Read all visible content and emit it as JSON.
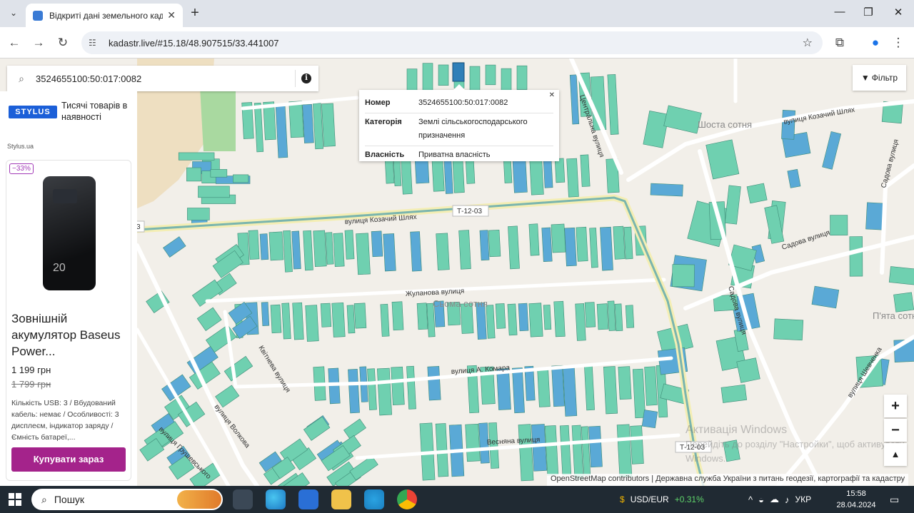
{
  "browser": {
    "tab_title": "Відкриті дані земельного када",
    "url": "kadastr.live/#15.18/48.907515/33.441007"
  },
  "search": {
    "value": "3524655100:50:017:0082"
  },
  "filter_label": "Фільтр",
  "popup": {
    "rows": [
      {
        "key": "Номер",
        "value": "3524655100:50:017:0082"
      },
      {
        "key": "Категорія",
        "value": "Землі сільськогосподарського призначення"
      },
      {
        "key": "Власність",
        "value": "Приватна власність"
      }
    ]
  },
  "map_labels": {
    "street_kozachyi_1": "вулиця Козачий Шлях",
    "street_kozachyi_2": "вулиця Козачий Шлях",
    "street_tsentralna": "Центральна вулиця",
    "street_zhulanova": "Жуланова вулиця",
    "street_komara": "вулиця А. Комара",
    "street_vesniana": "Весняна вулиця",
    "street_kvitneva": "Квітнева вулиця",
    "street_volkova": "вулиця Волкова",
    "street_hrushevskoho": "вулиця Грушевського",
    "street_sadova_1": "Садова вулиця",
    "street_sadova_2": "Садова вулиця",
    "street_sadova_3": "Садова вулиця",
    "street_shevchenka": "вулиця Шевченка",
    "area_shosta": "Шоста сотня",
    "area_soma": "Сьома сотня",
    "area_piata": "П'ята сотн",
    "road_1": "Т-12-03",
    "road_2": "Т-12-03",
    "road_3": "3"
  },
  "zoom": {
    "in": "+",
    "out": "−",
    "north": "▲"
  },
  "attribution": "OpenStreetMap contributors | Державна служба України з питань геодезії, картографії та кадастру",
  "watermark": {
    "line1": "Активація Windows",
    "line2": "Перейдіть до розділу \"Настройки\", щоб активувати Windows."
  },
  "ad": {
    "logo": "STYLUS",
    "tagline": "Тисячі товарів в наявності",
    "site": "Stylus.ua",
    "discount": "−33%",
    "product_num": "20",
    "title": "Зовнішній акумулятор Baseus Power...",
    "price": "1 199 грн",
    "old_price": "1 799 грн",
    "description": "Кількість USB: 3 / Вбудований кабель: немає / Особливості: 3 дисплеєм, індикатор заряду / Ємність батареї,...",
    "cta": "Купувати зараз"
  },
  "taskbar": {
    "search": "Пошук",
    "currency": "USD/EUR",
    "currency_change": "+0.31%",
    "lang": "УКР",
    "time": "15:58",
    "date": "28.04.2024"
  },
  "colors": {
    "parcel_green": "#6fd0b0",
    "parcel_blue": "#5aa9d6",
    "road_main": "#6fa9a0",
    "popup_bg": "#ffffff",
    "cta": "#a4238b"
  }
}
